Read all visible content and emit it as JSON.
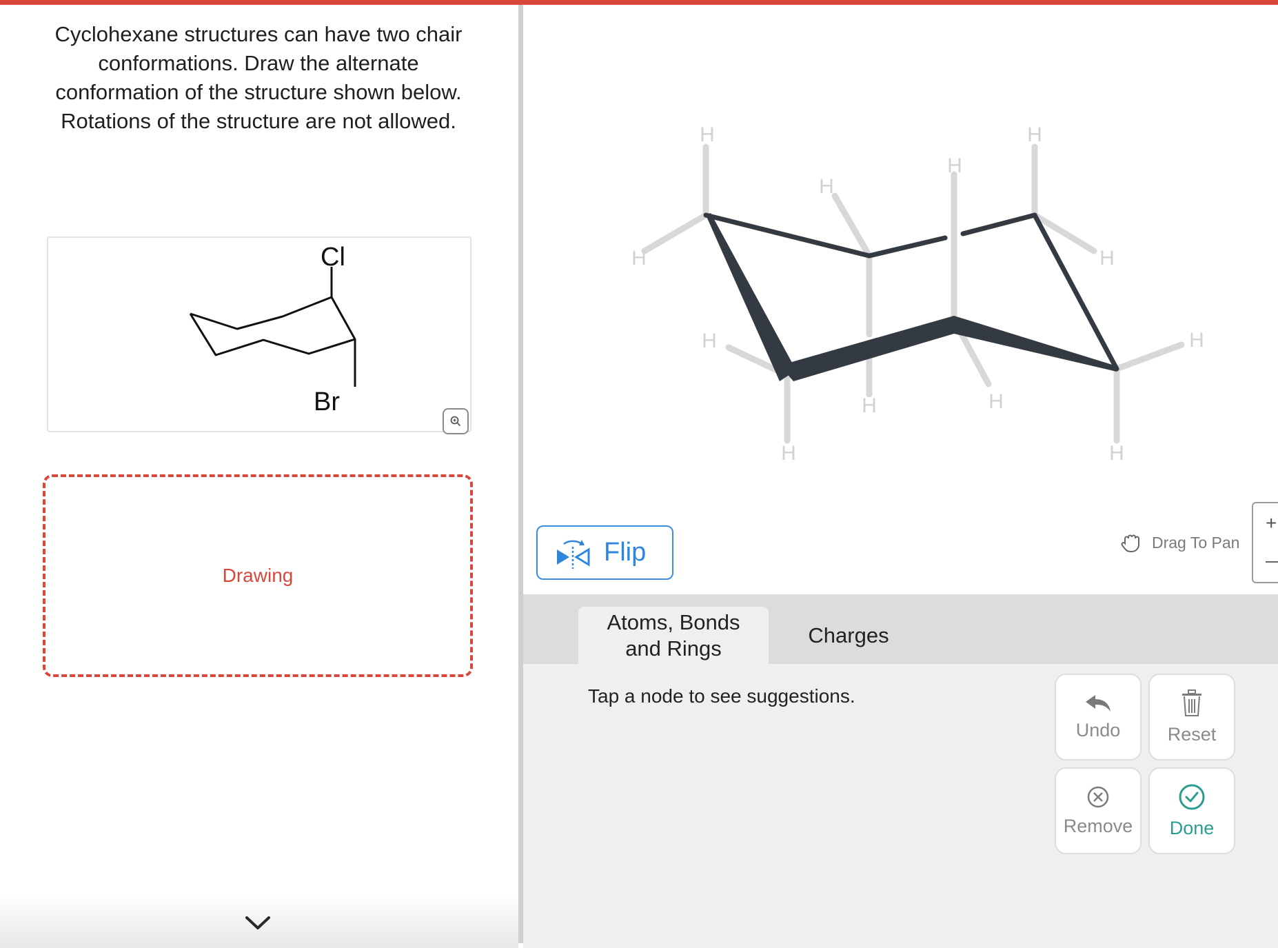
{
  "question": {
    "lines": [
      "Cyclohexane structures can have two chair",
      "conformations.  Draw the alternate",
      "conformation of the structure shown below.",
      "Rotations of the structure are not allowed."
    ]
  },
  "structure": {
    "atom_top": "Cl",
    "atom_bottom": "Br",
    "zoom_icon": "zoom-in-icon"
  },
  "drawing": {
    "label": "Drawing"
  },
  "canvas": {
    "hydrogen_label": "H"
  },
  "toolbar": {
    "flip_label": "Flip",
    "pan_hint": "Drag To Pan",
    "zoom_in": "+",
    "zoom_out": "−"
  },
  "tabs": [
    {
      "label": "Atoms, Bonds and Rings",
      "line1": "Atoms, Bonds",
      "line2": "and Rings",
      "active": true
    },
    {
      "label": "Charges",
      "active": false
    }
  ],
  "tools": {
    "hint": "Tap a node to see suggestions."
  },
  "actions": {
    "undo": "Undo",
    "reset": "Reset",
    "remove": "Remove",
    "done": "Done"
  },
  "colors": {
    "accent_red": "#d9473a",
    "flip_blue": "#2f86dd",
    "done_teal": "#2a9d8f",
    "bond_dark": "#343a42",
    "hydrogen_gray": "#d8d8d8"
  }
}
